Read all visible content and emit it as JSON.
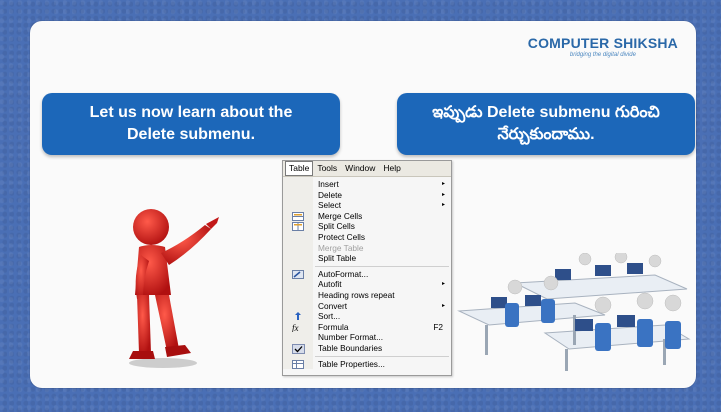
{
  "logo": {
    "title": "COMPUTER SHIKSHA",
    "tagline": "bridging the digital divide"
  },
  "bubbles": {
    "left": "Let us now learn about the\nDelete submenu.",
    "right": "ఇప్పుడు Delete submenu గురించి\nనేర్చుకుందాము."
  },
  "menu": {
    "menubar": [
      {
        "label": "Table",
        "active": true
      },
      {
        "label": "Tools"
      },
      {
        "label": "Window"
      },
      {
        "label": "Help"
      }
    ],
    "items": [
      {
        "label": "Insert",
        "submenu": true
      },
      {
        "label": "Delete",
        "submenu": true
      },
      {
        "label": "Select",
        "submenu": true
      },
      {
        "label": "Merge Cells",
        "icon": "merge-cells-icon"
      },
      {
        "label": "Split Cells",
        "icon": "split-cells-icon"
      },
      {
        "label": "Protect Cells"
      },
      {
        "label": "Merge Table",
        "disabled": true
      },
      {
        "label": "Split Table"
      },
      {
        "separator": true
      },
      {
        "label": "AutoFormat...",
        "icon": "autoformat-icon"
      },
      {
        "label": "Autofit",
        "submenu": true
      },
      {
        "label": "Heading rows repeat"
      },
      {
        "label": "Convert",
        "submenu": true
      },
      {
        "label": "Sort...",
        "icon": "sort-icon"
      },
      {
        "label": "Formula",
        "icon": "formula-icon",
        "shortcut": "F2"
      },
      {
        "label": "Number Format..."
      },
      {
        "label": "Table Boundaries",
        "checked": true
      },
      {
        "separator": true
      },
      {
        "label": "Table Properties...",
        "icon": "table-properties-icon"
      }
    ]
  },
  "colors": {
    "accent": "#1c67b9",
    "background": "#4a6fb5",
    "logo": "#2a68a8"
  }
}
